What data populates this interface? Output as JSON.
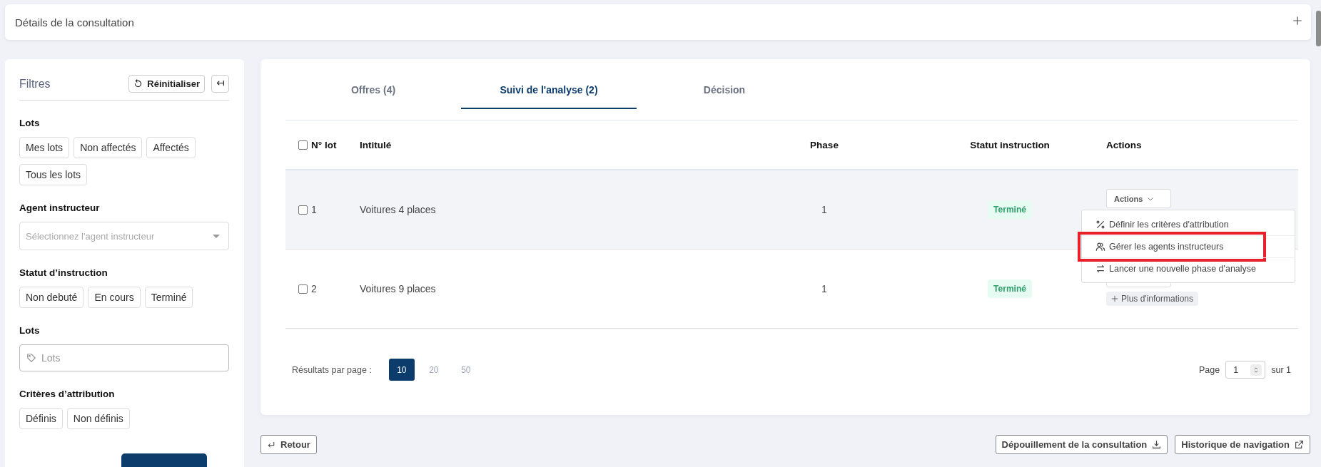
{
  "header": {
    "title": "Détails de la consultation"
  },
  "filters": {
    "title": "Filtres",
    "reset_label": "Réinitialiser",
    "groups": [
      {
        "kind": "chips",
        "label": "Lots",
        "chips": [
          "Mes lots",
          "Non affectés",
          "Affectés",
          "Tous les lots"
        ]
      },
      {
        "kind": "select",
        "label": "Agent instructeur",
        "placeholder": "Sélectionnez l'agent instructeur"
      },
      {
        "kind": "chips",
        "label": "Statut d’instruction",
        "chips": [
          "Non debuté",
          "En cours",
          "Terminé"
        ]
      },
      {
        "kind": "tags",
        "label": "Lots",
        "placeholder": "Lots"
      },
      {
        "kind": "chips",
        "label": "Critères d’attribution",
        "chips": [
          "Définis",
          "Non définis"
        ]
      }
    ]
  },
  "tabs": [
    {
      "label": "Offres (4)",
      "selected": false
    },
    {
      "label": "Suivi de l'analyse (2)",
      "selected": true
    },
    {
      "label": "Décision",
      "selected": false
    }
  ],
  "table": {
    "all_checked": false,
    "columns": [
      "N° lot",
      "Intitulé",
      "Phase",
      "Statut instruction",
      "Actions"
    ],
    "rows": [
      {
        "checked": false,
        "hovered": true,
        "lot": "1",
        "title": "Voitures 4 places",
        "phase": "1",
        "status": "Terminé",
        "actions": "Actions"
      },
      {
        "checked": false,
        "hovered": false,
        "lot": "2",
        "title": "Voitures 9 places",
        "phase": "1",
        "status": "Terminé",
        "more_info": "Plus d'informations"
      }
    ]
  },
  "menu": {
    "items": [
      {
        "kind": "percent",
        "label": "Définir les critères d'attribution",
        "highlighted": false
      },
      {
        "kind": "users",
        "label": "Gérer les agents instructeurs",
        "highlighted": true
      },
      {
        "kind": "swap",
        "label": "Lancer une nouvelle phase d'analyse",
        "highlighted": false
      }
    ]
  },
  "pagination": {
    "label": "Résultats par page :",
    "sizes": [
      {
        "label": "10",
        "selected": true
      },
      {
        "label": "20",
        "selected": false
      },
      {
        "label": "50",
        "selected": false
      }
    ],
    "page_label": "Page",
    "page_value": "1",
    "total": "sur 1"
  },
  "footer": {
    "back": "Retour",
    "buttons": [
      {
        "kind": "download",
        "label": "Dépouillement de la consultation"
      },
      {
        "kind": "external",
        "label": "Historique de navigation"
      }
    ]
  }
}
